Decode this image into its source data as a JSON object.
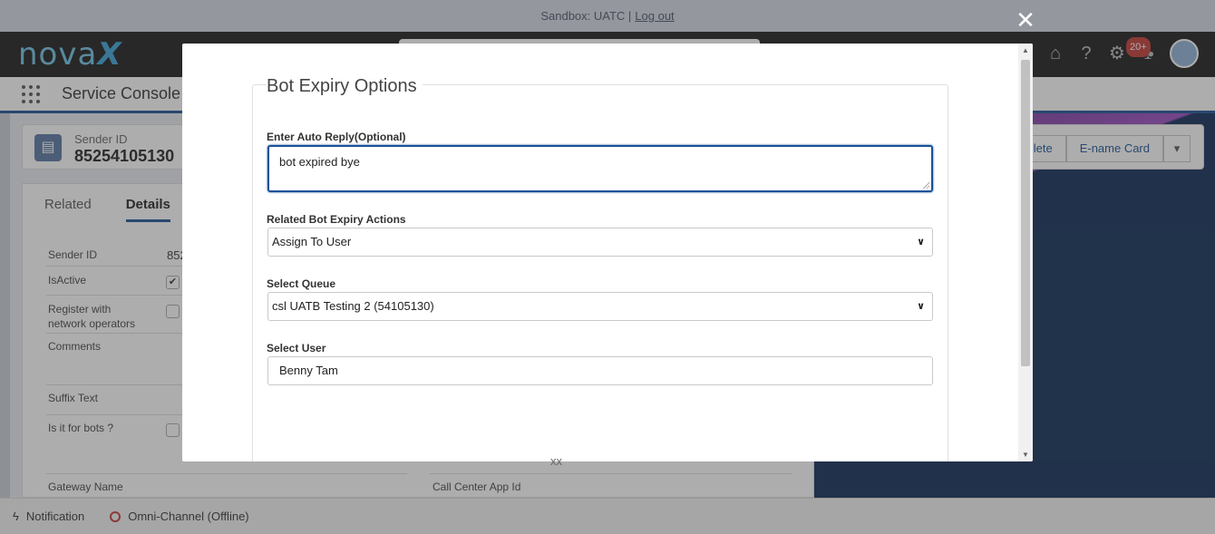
{
  "sandbox": {
    "text": "Sandbox: UATC |",
    "logout": "Log out"
  },
  "header": {
    "logo_text": "nova",
    "logo_x": "X",
    "notification_count": "20+"
  },
  "nav": {
    "app_title": "Service Console"
  },
  "record": {
    "label": "Sender ID",
    "value": "85254105130",
    "actions": [
      "lete",
      "E-name Card"
    ]
  },
  "detail": {
    "tabs": [
      "Related",
      "Details"
    ],
    "fields": {
      "sender_id": "Sender ID",
      "sender_id_value": "852",
      "is_active": "IsActive",
      "register_line1": "Register with",
      "register_line2": "network operators",
      "comments": "Comments",
      "suffix_text": "Suffix Text",
      "is_bots": "Is it for bots ?",
      "gateway_name": "Gateway Name",
      "call_center_app_id": "Call Center App Id"
    }
  },
  "status_bar": {
    "notification": "Notification",
    "omni": "Omni-Channel (Offline)"
  },
  "modal": {
    "title": "Bot Expiry Options",
    "auto_reply": {
      "label": "Enter Auto Reply(Optional)",
      "value": "bot expired bye"
    },
    "expiry_action": {
      "label": "Related Bot Expiry Actions",
      "selected": "Assign To User"
    },
    "queue": {
      "label": "Select Queue",
      "selected": "csl UATB Testing 2 (54105130)"
    },
    "user": {
      "label": "Select User",
      "value": "Benny Tam"
    },
    "footer_text": "xx"
  },
  "icons": {
    "close": "close-icon",
    "help": "help-icon",
    "settings": "gear-icon",
    "notification": "bell-icon"
  }
}
